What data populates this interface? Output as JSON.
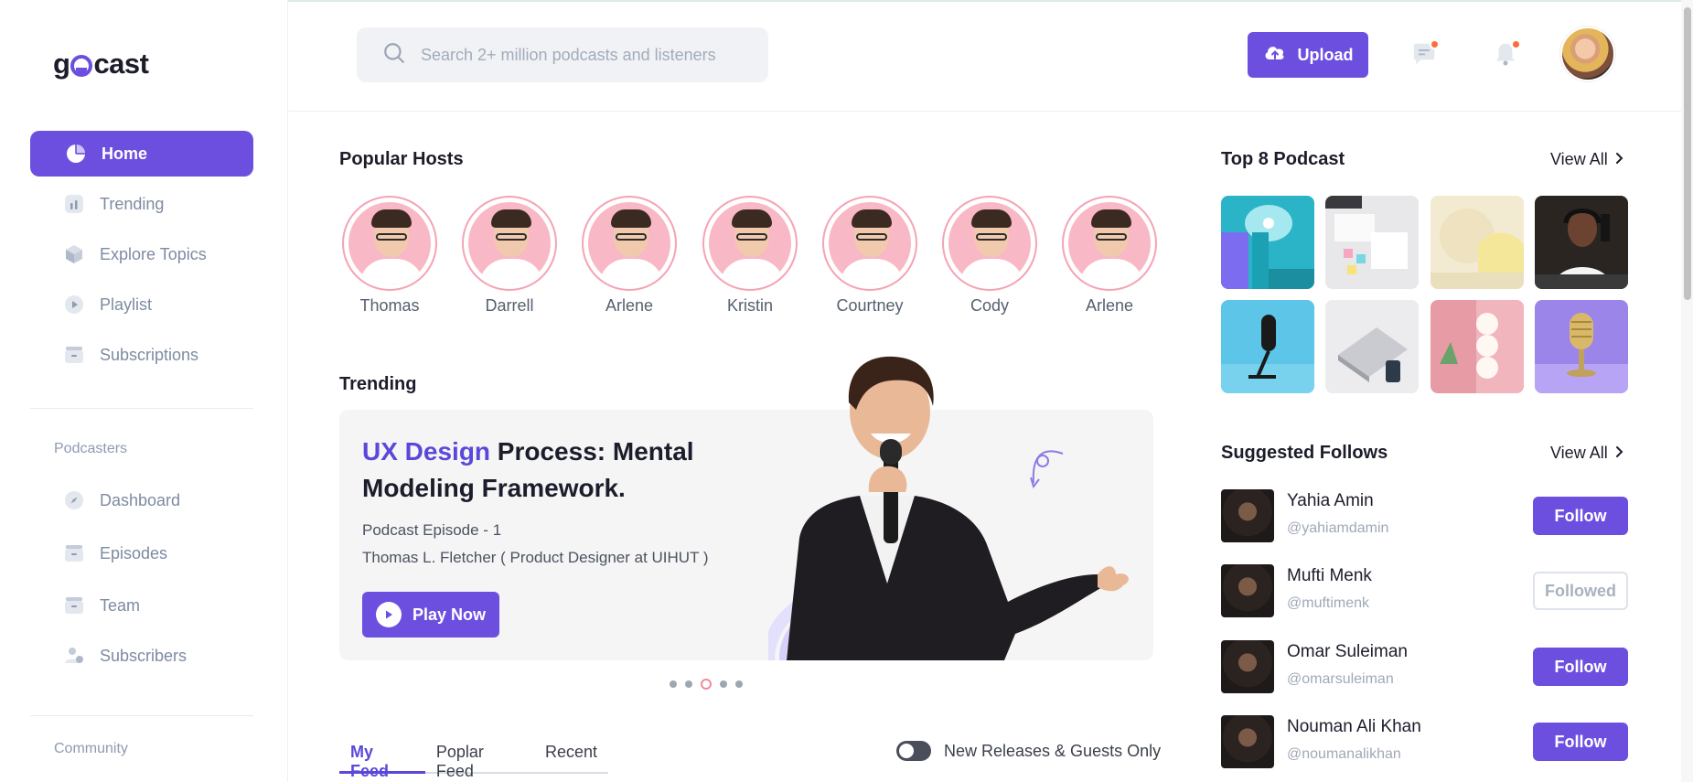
{
  "brand": {
    "logo_text_1": "g",
    "logo_text_2": "cast"
  },
  "colors": {
    "accent": "#6d4fe0",
    "badge": "#ff6a3d",
    "host_ring": "#f5a3b3"
  },
  "sidebar": {
    "items": [
      {
        "label": "Home",
        "icon": "pie-chart-icon",
        "active": true
      },
      {
        "label": "Trending",
        "icon": "bar-chart-icon"
      },
      {
        "label": "Explore Topics",
        "icon": "cube-icon"
      },
      {
        "label": "Playlist",
        "icon": "play-circle-icon"
      },
      {
        "label": "Subscriptions",
        "icon": "folder-icon"
      }
    ],
    "podcasters_label": "Podcasters",
    "podcaster_items": [
      {
        "label": "Dashboard",
        "icon": "compass-icon"
      },
      {
        "label": "Episodes",
        "icon": "folder-icon"
      },
      {
        "label": "Team",
        "icon": "folder-icon"
      },
      {
        "label": "Subscribers",
        "icon": "users-icon"
      }
    ],
    "community_label": "Community"
  },
  "header": {
    "search_placeholder": "Search 2+ million podcasts and listeners",
    "upload_label": "Upload",
    "icons": [
      "message-icon",
      "bell-icon"
    ]
  },
  "popular_hosts": {
    "title": "Popular Hosts",
    "hosts": [
      "Thomas",
      "Darrell",
      "Arlene",
      "Kristin",
      "Courtney",
      "Cody",
      "Arlene"
    ]
  },
  "trending": {
    "title": "Trending",
    "card": {
      "title_accent": "UX Design",
      "title_rest": " Process: Mental Modeling Framework.",
      "episode": "Podcast Episode - 1",
      "author": "Thomas L. Fletcher ( Product Designer at UIHUT )",
      "play_label": "Play Now"
    },
    "carousel": {
      "count": 5,
      "active_index": 2
    }
  },
  "feed": {
    "tabs": [
      "My Feed",
      "Poplar Feed",
      "Recent"
    ],
    "active_tab": 0,
    "toggle_label": "New Releases & Guests Only",
    "toggle_on": false
  },
  "top_podcasts": {
    "title": "Top 8 Podcast",
    "view_all": "View All",
    "thumbnails": [
      "microphone-teal",
      "sticky-notes",
      "yellow-shapes",
      "man-headphones",
      "studio-mic-blue",
      "laptop-desk",
      "pink-balls",
      "retro-mic-purple"
    ]
  },
  "suggested_follows": {
    "title": "Suggested Follows",
    "view_all": "View All",
    "people": [
      {
        "name": "Yahia Amin",
        "handle": "@yahiamdamin",
        "button": "Follow",
        "followed": false
      },
      {
        "name": "Mufti Menk",
        "handle": "@muftimenk",
        "button": "Followed",
        "followed": true
      },
      {
        "name": "Omar Suleiman",
        "handle": "@omarsuleiman",
        "button": "Follow",
        "followed": false
      },
      {
        "name": "Nouman Ali Khan",
        "handle": "@noumanalikhan",
        "button": "Follow",
        "followed": false
      }
    ]
  }
}
